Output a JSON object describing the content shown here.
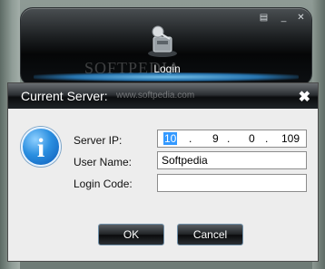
{
  "login_panel": {
    "label": "Login",
    "menu_icon": "menu-icon",
    "minimize_icon": "minimize-icon",
    "close_icon": "close-icon"
  },
  "watermark": {
    "brand": "SOFTPEDIA",
    "url": "www.softpedia.com"
  },
  "dialog": {
    "title": "Current Server:",
    "close_glyph": "✖",
    "info_glyph": "i",
    "labels": {
      "server_ip": "Server IP:",
      "user_name": "User Name:",
      "login_code": "Login Code:"
    },
    "server_ip": [
      "10",
      "9",
      "0",
      "109"
    ],
    "ip_separator": ".",
    "user_name": "Softpedia",
    "login_code": "",
    "ok_label": "OK",
    "cancel_label": "Cancel"
  },
  "colors": {
    "selection": "#3399ff",
    "glow": "#7fd2ff"
  }
}
